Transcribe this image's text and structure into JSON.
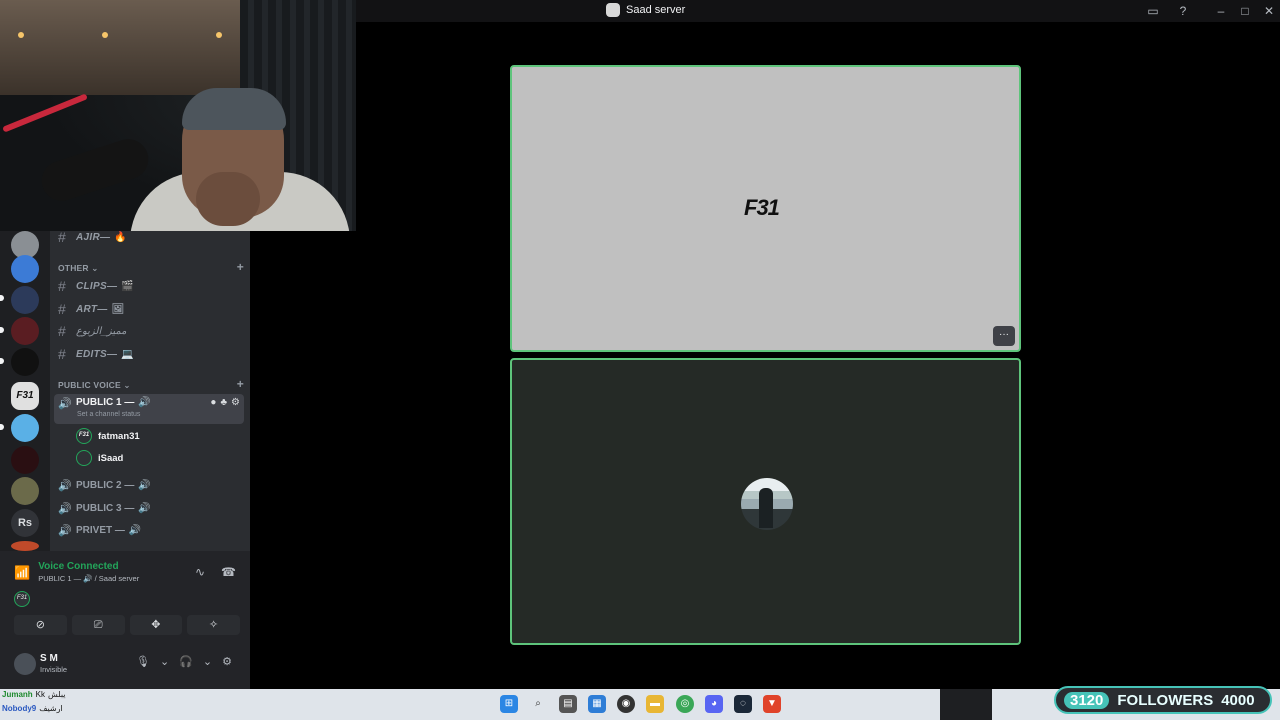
{
  "window": {
    "title": "Saad server"
  },
  "channels": {
    "top_channel": {
      "name": "AJIR—",
      "emoji": "🔥"
    },
    "other_category": "OTHER",
    "other": [
      {
        "name": "CLIPS—",
        "emoji": "🎬"
      },
      {
        "name": "ART—",
        "emoji": "🖼"
      },
      {
        "name": "مميز_الزبوع",
        "emoji": ""
      },
      {
        "name": "EDITS—",
        "emoji": "💻"
      }
    ],
    "voice_category": "PUBLIC VOICE",
    "voice": [
      {
        "name": "PUBLIC 1 —",
        "status": "Set a channel status"
      },
      {
        "name": "PUBLIC 2 —"
      },
      {
        "name": "PUBLIC 3 —"
      },
      {
        "name": "PRIVET —"
      }
    ],
    "voice_users": [
      {
        "name": "fatman31",
        "avatar": "F31"
      },
      {
        "name": "iSaad",
        "avatar": ""
      }
    ]
  },
  "guilds": {
    "f31": "F31",
    "rs": "Rs"
  },
  "panel": {
    "voice_connected": "Voice Connected",
    "voice_location": "PUBLIC 1 — 🔊 / Saad server",
    "mini_avatar": "F31",
    "user_name": "S M",
    "user_status": "Invisible"
  },
  "stage": {
    "tile1_logo": "F31",
    "more_label": "···"
  },
  "taskbar": {
    "chat": [
      {
        "name": "Jumanh",
        "badge": "Kk",
        "text": "يبلش"
      },
      {
        "name": "Nobody9",
        "badge": "",
        "text": "ارشيف"
      }
    ]
  },
  "followers": {
    "current": "3120",
    "label": "FOLLOWERS",
    "goal": "4000"
  },
  "colors": {
    "voice_green": "#23a55a",
    "tile_border": "#5ec47b",
    "followers_accent": "#46c3b8"
  }
}
